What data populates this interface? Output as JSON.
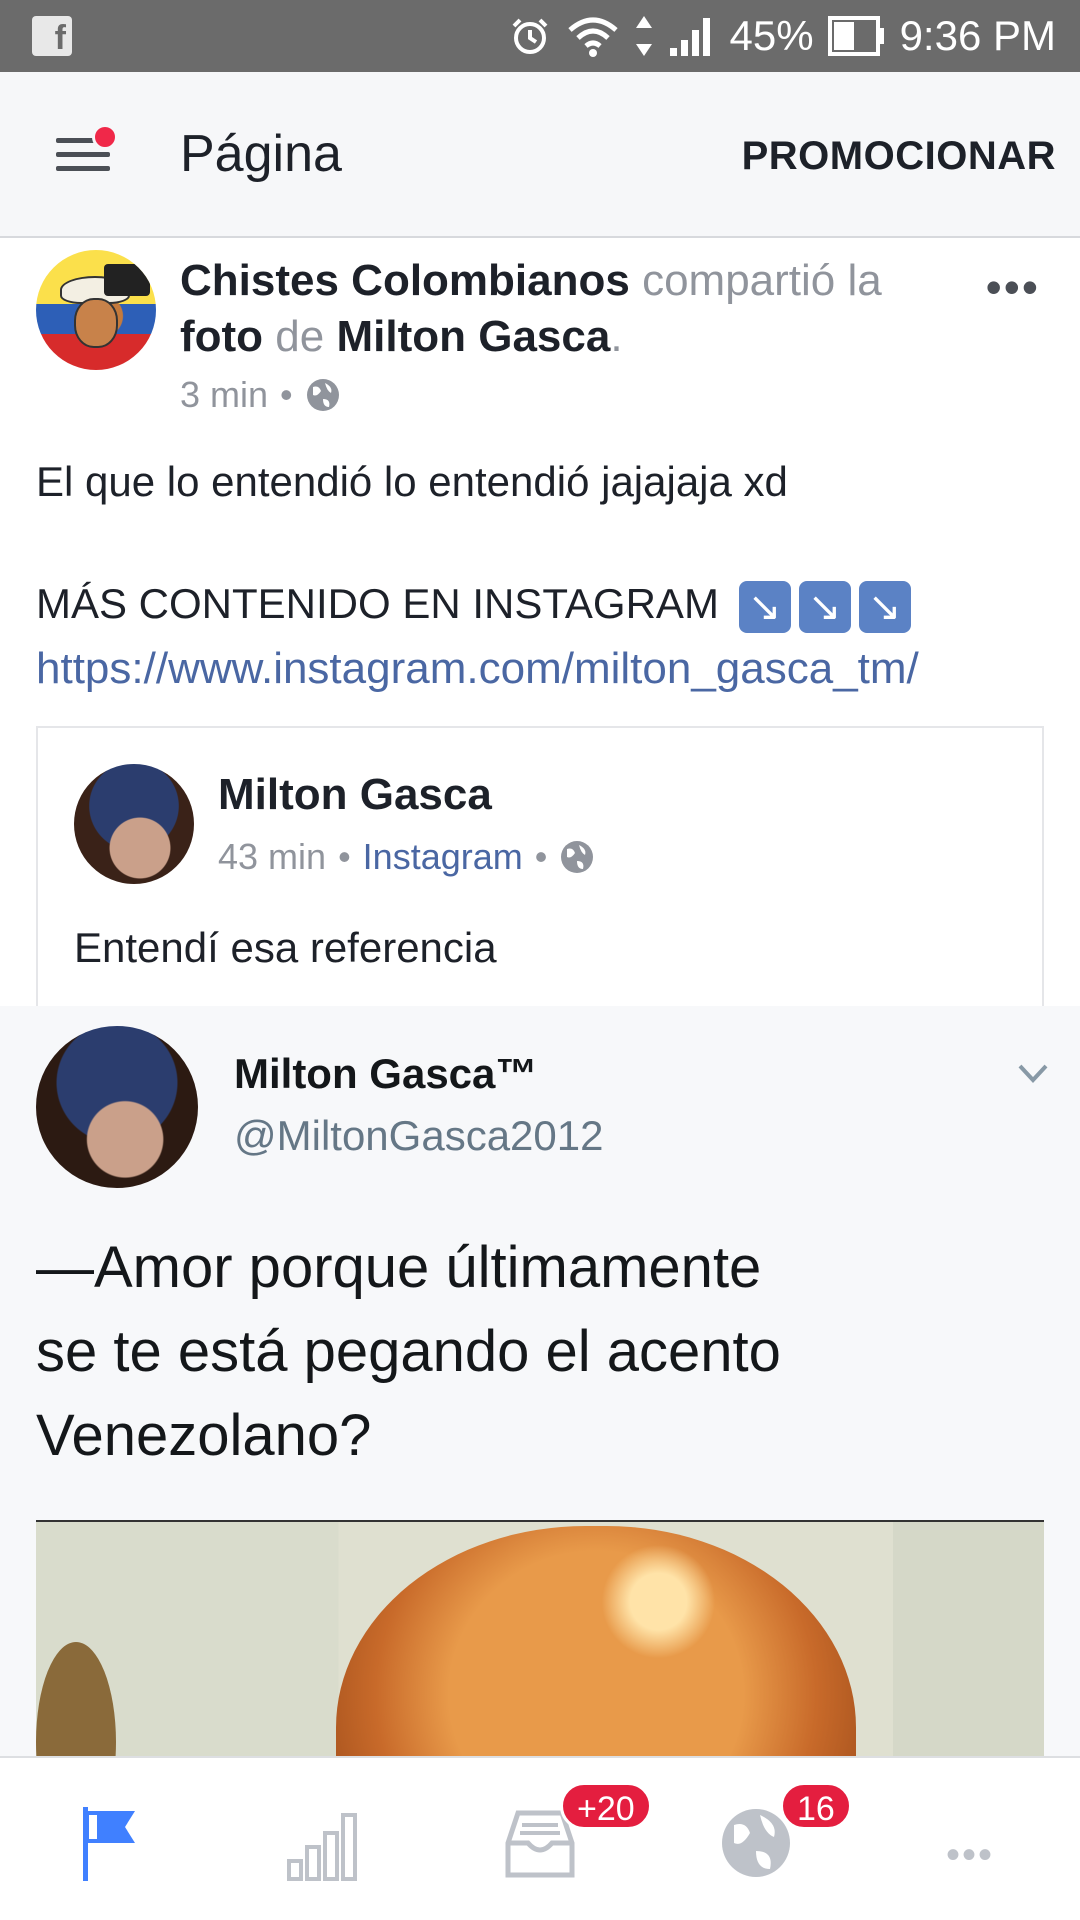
{
  "status_bar": {
    "battery": "45%",
    "time": "9:36 PM"
  },
  "header": {
    "title": "Página",
    "action": "PROMOCIONAR"
  },
  "post": {
    "page_name": "Chistes Colombianos",
    "shared_text": "compartió la",
    "foto": "foto",
    "de": "de",
    "original_author": "Milton Gasca",
    "period": ".",
    "time": "3 min",
    "dot": "•",
    "text": "El que lo entendió lo entendió jajajaja xd",
    "promo": "MÁS CONTENIDO EN INSTAGRAM",
    "arrow": "↘",
    "link": "https://www.instagram.com/milton_gasca_tm/"
  },
  "shared": {
    "author": "Milton Gasca",
    "time": "43 min",
    "source": "Instagram",
    "dot": "•",
    "text": "Entendí esa referencia"
  },
  "tweet": {
    "name": "Milton Gasca™",
    "handle": "@MiltonGasca2012",
    "line1": "—Amor porque últimamente",
    "line2": "se te está pegando el acento",
    "line3": "Venezolano?"
  },
  "bottom_nav": {
    "notifications_badge": "+20",
    "globe_badge": "16",
    "more": "•••"
  },
  "colors": {
    "brand_blue": "#4a67a3",
    "badge_red": "#e41e3f",
    "active_tab": "#4080ff"
  }
}
